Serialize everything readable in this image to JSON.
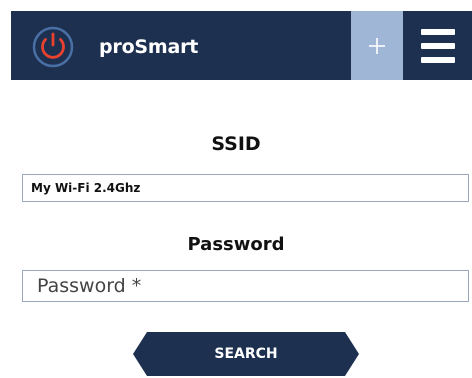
{
  "header": {
    "brand": "proSmart",
    "add_icon": "plus-icon",
    "menu_icon": "hamburger-menu-icon",
    "logo_icon": "power-icon",
    "colors": {
      "bar": "#1d3050",
      "add_button": "#9fb6d6",
      "logo_accent": "#e8422f"
    }
  },
  "form": {
    "ssid_label": "SSID",
    "ssid_value": "My Wi-Fi 2.4Ghz",
    "password_label": "Password",
    "password_placeholder": "Password *",
    "password_value": "",
    "search_label": "SEARCH"
  }
}
